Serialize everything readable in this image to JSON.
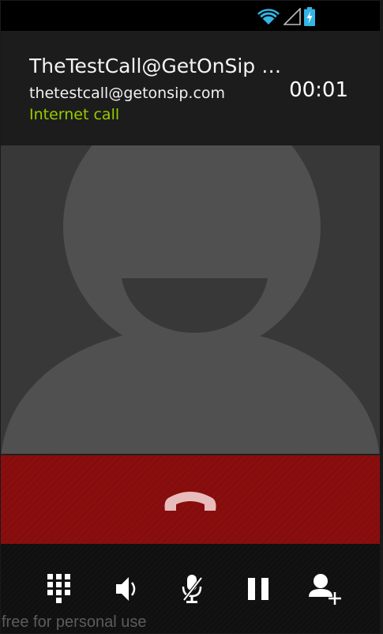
{
  "status_bar": {
    "icons": [
      "wifi-icon",
      "signal-icon",
      "battery-charging-icon"
    ]
  },
  "call": {
    "name": "TheTestCall@GetOnSip c…",
    "address": "thetestcall@getonsip.com",
    "type": "Internet call",
    "timer": "00:01"
  },
  "end_call": {
    "icon": "end-call-icon",
    "color": "#8b0e0e"
  },
  "controls": [
    {
      "icon": "dialpad-icon"
    },
    {
      "icon": "speaker-icon"
    },
    {
      "icon": "mute-microphone-icon"
    },
    {
      "icon": "hold-icon"
    },
    {
      "icon": "add-call-icon"
    }
  ],
  "watermark": "free for personal use",
  "colors": {
    "accent_green": "#99cc00",
    "status_blue": "#33b5e5",
    "end_red": "#8b0e0e"
  }
}
